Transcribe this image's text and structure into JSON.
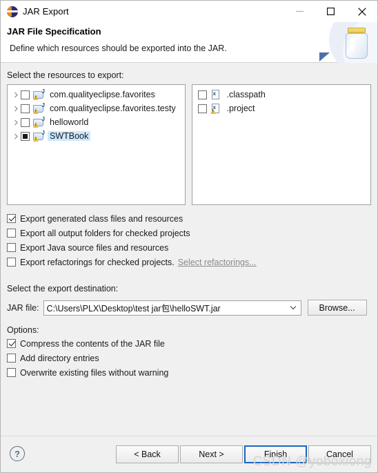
{
  "window": {
    "title": "JAR Export",
    "icon": "eclipse-icon",
    "minimize": "minimize-icon",
    "maximize": "maximize-icon",
    "close": "close-icon"
  },
  "banner": {
    "title": "JAR File Specification",
    "description": "Define which resources should be exported into the JAR.",
    "art_icon": "jar-bottle-icon"
  },
  "resources": {
    "label": "Select the resources to export:",
    "tree": [
      {
        "label": "com.qualityeclipse.favorites",
        "checkbox": "unchecked",
        "expandable": true,
        "selected": false,
        "icon": "java-project-icon"
      },
      {
        "label": "com.qualityeclipse.favorites.testy",
        "checkbox": "unchecked",
        "expandable": true,
        "selected": false,
        "icon": "java-project-icon"
      },
      {
        "label": "helloworld",
        "checkbox": "unchecked",
        "expandable": true,
        "selected": false,
        "icon": "java-project-icon"
      },
      {
        "label": "SWTBook",
        "checkbox": "grayed",
        "expandable": true,
        "selected": true,
        "icon": "java-project-icon"
      }
    ],
    "files": [
      {
        "label": ".classpath",
        "checkbox": "unchecked",
        "icon": "xml-file-icon",
        "warning": false
      },
      {
        "label": ".project",
        "checkbox": "unchecked",
        "icon": "xml-file-icon",
        "warning": true
      }
    ]
  },
  "export_options": [
    {
      "label": "Export generated class files and resources",
      "checkbox": "checked"
    },
    {
      "label": "Export all output folders for checked projects",
      "checkbox": "unchecked"
    },
    {
      "label": "Export Java source files and resources",
      "checkbox": "unchecked"
    },
    {
      "label": "Export refactorings for checked projects.",
      "checkbox": "unchecked",
      "link": "Select refactorings..."
    }
  ],
  "destination": {
    "label": "Select the export destination:",
    "jar_file_label": "JAR file:",
    "jar_file_value": "C:\\Users\\PLX\\Desktop\\test jar包\\helloSWT.jar",
    "browse_label": "Browse..."
  },
  "options": {
    "label": "Options:",
    "items": [
      {
        "label": "Compress the contents of the JAR file",
        "checkbox": "checked"
      },
      {
        "label": "Add directory entries",
        "checkbox": "unchecked"
      },
      {
        "label": "Overwrite existing files without warning",
        "checkbox": "unchecked"
      }
    ]
  },
  "footer": {
    "help": "?",
    "buttons": [
      {
        "label": "< Back",
        "default": false
      },
      {
        "label": "Next >",
        "default": false
      },
      {
        "label": "Finish",
        "default": true
      },
      {
        "label": "Cancel",
        "default": false
      }
    ]
  },
  "watermark": "CSDN @yoboxiong",
  "colors": {
    "accent": "#1667c1",
    "selection": "#cde8ff",
    "dialog_bg": "#f0f0f0"
  }
}
